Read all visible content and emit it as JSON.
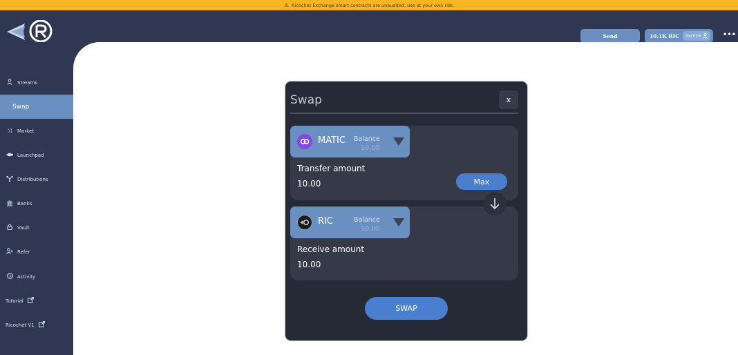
{
  "banner": {
    "icon": "warning-icon",
    "text": "Ricochet Exchange smart contracts are unaudited, use at your own risk."
  },
  "header": {
    "logo": "ricochet-logo",
    "send_label": "Send",
    "balance": "10.1K RIC",
    "address": "0xc016",
    "more_icon": "ellipsis-icon"
  },
  "sidebar": {
    "items": [
      {
        "label": "Streams",
        "icon": "user-icon"
      },
      {
        "label": "Swap",
        "icon": ""
      },
      {
        "label": "Market",
        "icon": "shuffle-icon"
      },
      {
        "label": "Launchpad",
        "icon": "rocket-icon"
      },
      {
        "label": "Distributions",
        "icon": "share-icon"
      },
      {
        "label": "Banks",
        "icon": "bank-icon"
      },
      {
        "label": "Vault",
        "icon": "lock-icon"
      },
      {
        "label": "Refer",
        "icon": "user-plus-icon"
      },
      {
        "label": "Activity",
        "icon": "clock-icon"
      },
      {
        "label": "Tutorial",
        "icon": "external-link-icon"
      },
      {
        "label": "Ricochet V1",
        "icon": "external-link-icon"
      }
    ],
    "active": "Swap"
  },
  "swap": {
    "title": "Swap",
    "close_label": "x",
    "from": {
      "token": "MATIC",
      "balance_label": "Balance",
      "balance_value": "10.00",
      "amount_label": "Transfer amount",
      "amount_value": "10.00",
      "max_label": "Max"
    },
    "to": {
      "token": "RIC",
      "balance_label": "Balance",
      "balance_value": "10.00",
      "amount_label": "Receive amount",
      "amount_value": "10.00"
    },
    "swap_label": "SWAP"
  },
  "colors": {
    "banner": "#f7b524",
    "sidebar": "#2f3752",
    "accent": "#6a90c2",
    "button": "#4a7fcf",
    "modal": "#252a36"
  }
}
